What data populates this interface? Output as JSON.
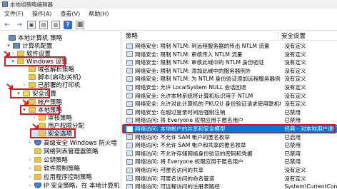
{
  "window": {
    "title": "本地组策略编辑器"
  },
  "menu": [
    "文件(F)",
    "操作(A)",
    "查看(V)",
    "帮助(H)"
  ],
  "toolbar": [
    {
      "name": "back-arrow-icon",
      "glyph": "←"
    },
    {
      "name": "forward-arrow-icon",
      "glyph": "→"
    },
    {
      "name": "up-folder-icon",
      "glyph": "▣"
    },
    {
      "name": "show-hide-tree-icon",
      "glyph": "▤"
    },
    {
      "name": "export-list-icon",
      "glyph": "▥"
    },
    {
      "name": "help-icon",
      "glyph": "?"
    },
    {
      "name": "properties-icon",
      "glyph": "▦"
    }
  ],
  "tree": {
    "items": [
      {
        "label": "本地计算机 策略",
        "exp": "",
        "icon": "comp"
      },
      {
        "label": "计算机配置",
        "exp": "▾",
        "icon": "comp"
      },
      {
        "label": "软件设置",
        "exp": "›",
        "icon": "folder"
      },
      {
        "label": "Windows 设置",
        "exp": "▾",
        "icon": "folder"
      },
      {
        "label": "域名解析策略",
        "exp": "",
        "icon": "folder"
      },
      {
        "label": "脚本(启动/关机)",
        "exp": "",
        "icon": "folder"
      },
      {
        "label": "已部署的打印机",
        "exp": "›",
        "icon": "folder"
      },
      {
        "label": "安全设置",
        "exp": "▾",
        "icon": "key"
      },
      {
        "label": "帐户策略",
        "exp": "›",
        "icon": "folder"
      },
      {
        "label": "本地策略",
        "exp": "▾",
        "icon": "folder"
      },
      {
        "label": "审核策略",
        "exp": "›",
        "icon": "folder"
      },
      {
        "label": "用户权限分配",
        "exp": "›",
        "icon": "folder"
      },
      {
        "label": "安全选项",
        "exp": "",
        "icon": "folder"
      },
      {
        "label": "高级安全 Windows 防火墙",
        "exp": "›",
        "icon": "shield"
      },
      {
        "label": "网络列表管理器策略",
        "exp": "",
        "icon": "folder"
      },
      {
        "label": "公钥策略",
        "exp": "›",
        "icon": "folder"
      },
      {
        "label": "软件限制策略",
        "exp": "›",
        "icon": "folder"
      },
      {
        "label": "应用程序控制策略",
        "exp": "›",
        "icon": "folder"
      },
      {
        "label": "IP 安全策略，在 本地计算机",
        "exp": "›",
        "icon": "shield"
      },
      {
        "label": "高级审核策略配置",
        "exp": "›",
        "icon": "folder"
      }
    ]
  },
  "list": {
    "col_policy": "策略",
    "col_setting": "安全设置",
    "rows": [
      {
        "name": "网络安全: 限制 NTLM: 到远程服务器的传出 NTLM 流量",
        "val": "没有定义"
      },
      {
        "name": "网络安全: 限制 NTLM: 审核传入 NTLM 流量",
        "val": "没有定义"
      },
      {
        "name": "网络安全: 限制 NTLM: 审核此域中的 NTLM 身份验证",
        "val": "没有定义"
      },
      {
        "name": "网络安全: 限制 NTLM: 添加此域中的服务器例外",
        "val": "没有定义"
      },
      {
        "name": "网络安全: 限制 NTLM: 为 NTLM 身份验证添加远程服务器例外",
        "val": "没有定义"
      },
      {
        "name": "网络安全: 允许 LocalSystem NULL 会话回退",
        "val": "没有定义"
      },
      {
        "name": "网络安全: 允许本地系统将计算机标识用于 NTLM",
        "val": "没有定义"
      },
      {
        "name": "网络安全: 允许对此计算机的 PKU2U 身份验证请求使用联机标识",
        "val": "没有定义"
      },
      {
        "name": "网络安全: 在超过登录时间后强制注销",
        "val": "已禁用"
      },
      {
        "name": "网络访问: 将 Everyone 权限应用于匿名用户",
        "val": "已禁用"
      },
      {
        "name": "网络访问: 本地帐户的共享和安全模型",
        "val": "经典 - 对本地用户进行"
      },
      {
        "name": "网络访问: 不允许 SAM 帐户的匿名枚举",
        "val": "已启用"
      },
      {
        "name": "网络访问: 不允许 SAM 帐户和共享的匿名枚举",
        "val": "已禁用"
      },
      {
        "name": "网络访问: 不允许存储网络身份验证的密码和凭据",
        "val": "已禁用"
      },
      {
        "name": "网络访问: 将 Everyone 权限应用于匿名用户",
        "val": "已禁用"
      },
      {
        "name": "网络访问: 可匿名访问的共享",
        "val": "没有定义"
      },
      {
        "name": "网络访问: 可匿名访问的命名管道",
        "val": "没有定义"
      },
      {
        "name": "网络访问: 可远程访问的注册表路径",
        "val": "System\\CurrentControl"
      }
    ],
    "selected_index": 10
  }
}
